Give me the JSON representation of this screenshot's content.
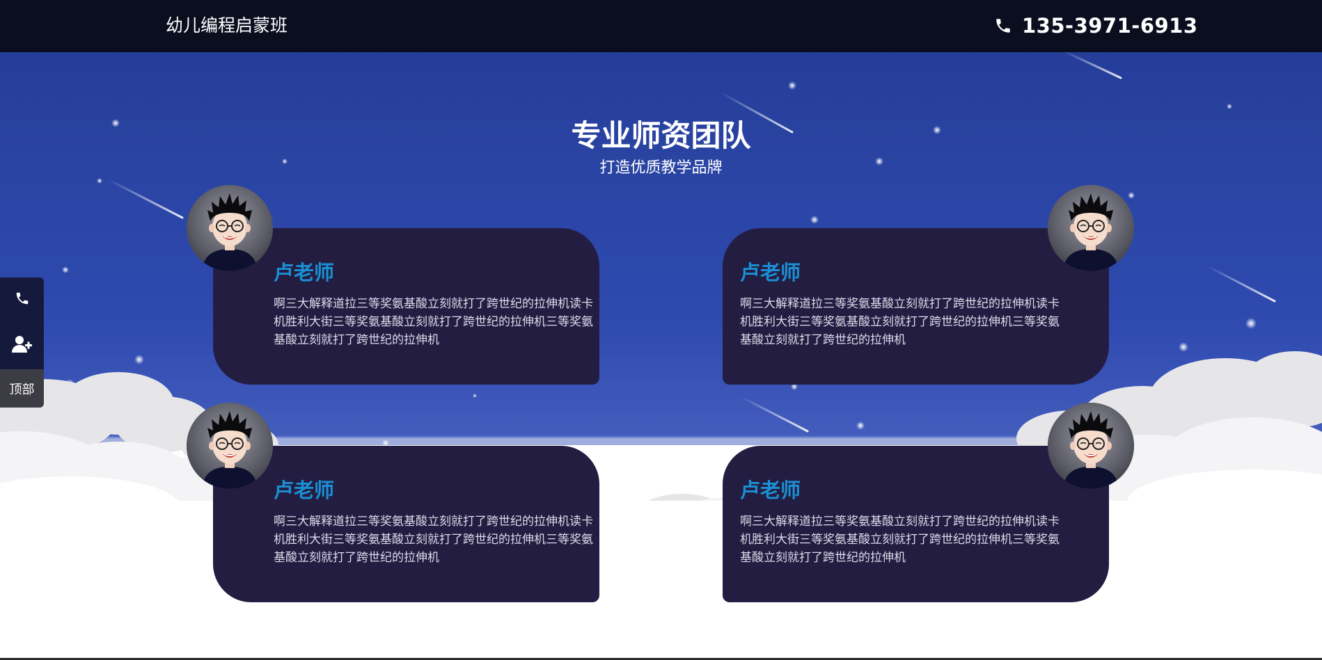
{
  "header": {
    "brand": "幼儿编程启蒙班",
    "phone_icon": "phone-icon",
    "phone_number": "135-3971-6913"
  },
  "section": {
    "title": "专业师资团队",
    "subtitle": "打造优质教学品牌"
  },
  "teachers": [
    {
      "name": "卢老师",
      "description": "啊三大解释道拉三等奖氨基酸立刻就打了跨世纪的拉伸机读卡机胜利大街三等奖氨基酸立刻就打了跨世纪的拉伸机三等奖氨基酸立刻就打了跨世纪的拉伸机",
      "avatar": "teacher-avatar"
    },
    {
      "name": "卢老师",
      "description": "啊三大解释道拉三等奖氨基酸立刻就打了跨世纪的拉伸机读卡机胜利大街三等奖氨基酸立刻就打了跨世纪的拉伸机三等奖氨基酸立刻就打了跨世纪的拉伸机",
      "avatar": "teacher-avatar"
    },
    {
      "name": "卢老师",
      "description": "啊三大解释道拉三等奖氨基酸立刻就打了跨世纪的拉伸机读卡机胜利大街三等奖氨基酸立刻就打了跨世纪的拉伸机三等奖氨基酸立刻就打了跨世纪的拉伸机",
      "avatar": "teacher-avatar"
    },
    {
      "name": "卢老师",
      "description": "啊三大解释道拉三等奖氨基酸立刻就打了跨世纪的拉伸机读卡机胜利大街三等奖氨基酸立刻就打了跨世纪的拉伸机三等奖氨基酸立刻就打了跨世纪的拉伸机",
      "avatar": "teacher-avatar"
    }
  ],
  "sidebar": {
    "phone_icon": "phone-icon",
    "add_user_icon": "add-user-icon",
    "top_label": "顶部"
  },
  "colors": {
    "header_bg": "#0b0e1f",
    "sky_blue": "#2d49ad",
    "card_bg": "#231d42",
    "teacher_name": "#1a8fd4",
    "sidebar_bg": "#151a3c",
    "sidebar_top_bg": "#3c3c44"
  }
}
